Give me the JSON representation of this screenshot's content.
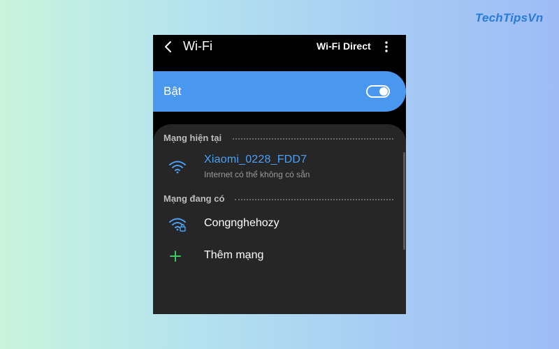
{
  "watermark": "TechTipsVn",
  "header": {
    "title": "Wi-Fi",
    "wifi_direct_label": "Wi-Fi Direct",
    "back_icon": "chevron-left-icon",
    "more_icon": "more-vertical-icon"
  },
  "wifi_toggle": {
    "label": "Bật",
    "state": "on"
  },
  "current_network": {
    "section_label": "Mạng hiện tại",
    "name": "Xiaomi_0228_FDD7",
    "status": "Internet có thể không có sẵn",
    "icon": "wifi-icon"
  },
  "available_networks": {
    "section_label": "Mạng đang có",
    "items": [
      {
        "name": "Congnghehozy",
        "icon": "wifi-locked-icon"
      }
    ]
  },
  "add_network": {
    "label": "Thêm mạng",
    "icon": "plus-icon"
  },
  "colors": {
    "accent": "#4a97ef",
    "connected_text": "#4da0f4",
    "plus_green": "#3ccb5f",
    "background": "#000000",
    "card": "#262626"
  }
}
